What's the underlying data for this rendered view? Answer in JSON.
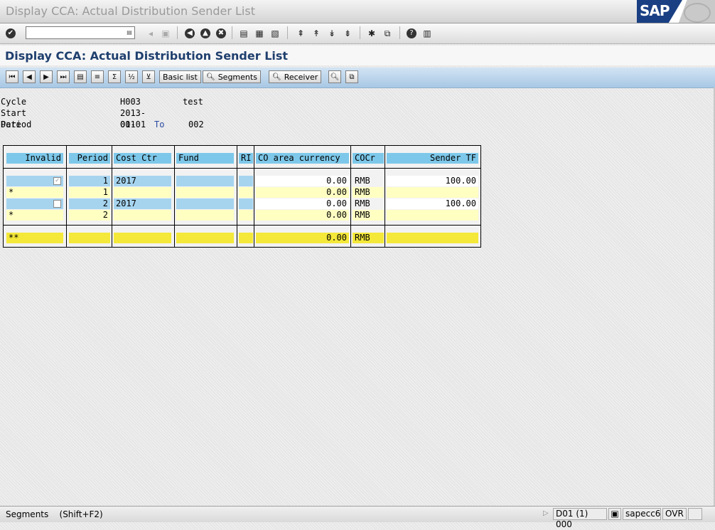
{
  "window": {
    "title": "Display CCA: Actual Distribution Sender List"
  },
  "brand": {
    "logo_text": "SAP",
    "colors": {
      "logo": "#1a3f83",
      "header_blue": "#7dc8ea",
      "row_yellow": "#ffffc2",
      "total_yellow": "#f4e83a"
    }
  },
  "toolbar": {
    "command_placeholder": "",
    "icons": [
      "enter-icon",
      "command-dropdown-icon",
      "back-arrow-icon",
      "save-icon",
      "back-icon",
      "exit-icon",
      "cancel-icon",
      "print-icon",
      "find-icon",
      "find-next-icon",
      "first-page-icon",
      "previous-page-icon",
      "next-page-icon",
      "last-page-icon",
      "create-session-icon",
      "create-shortcut-icon",
      "help-icon",
      "customize-layout-icon"
    ]
  },
  "page": {
    "title": "Display CCA: Actual Distribution Sender List"
  },
  "app_toolbar": {
    "basic_list_label": "Basic list",
    "segments_label": "Segments",
    "receiver_label": "Receiver"
  },
  "header": {
    "cycle_label": "Cycle",
    "cycle_value": "H003",
    "cycle_text": "test",
    "start_date_label": "Start Date",
    "start_date_value": "2013-01-01",
    "period_label": "Period",
    "period_from": "001",
    "period_to_label": "To",
    "period_to": "002"
  },
  "table": {
    "columns": [
      "Invalid",
      "Period",
      "Cost Ctr",
      "Fund",
      "RI",
      "CO area currency",
      "COCr",
      "Sender TF"
    ],
    "rows": [
      {
        "marker": "",
        "invalid": true,
        "period": "1",
        "cost_ctr": "2017",
        "fund": "",
        "ri": "",
        "amount": "0.00",
        "cocr": "RMB",
        "sender_tf": "100.00"
      },
      {
        "marker": "*",
        "invalid": null,
        "period": "1",
        "cost_ctr": "",
        "fund": "",
        "ri": "",
        "amount": "0.00",
        "cocr": "RMB",
        "sender_tf": ""
      },
      {
        "marker": "",
        "invalid": false,
        "period": "2",
        "cost_ctr": "2017",
        "fund": "",
        "ri": "",
        "amount": "0.00",
        "cocr": "RMB",
        "sender_tf": "100.00"
      },
      {
        "marker": "*",
        "invalid": null,
        "period": "2",
        "cost_ctr": "",
        "fund": "",
        "ri": "",
        "amount": "0.00",
        "cocr": "RMB",
        "sender_tf": ""
      }
    ],
    "total": {
      "marker": "**",
      "amount": "0.00",
      "cocr": "RMB"
    }
  },
  "status": {
    "message": "Segments    (Shift+F2)",
    "system": "D01 (1) 000",
    "server": "sapecc6",
    "mode": "OVR"
  }
}
